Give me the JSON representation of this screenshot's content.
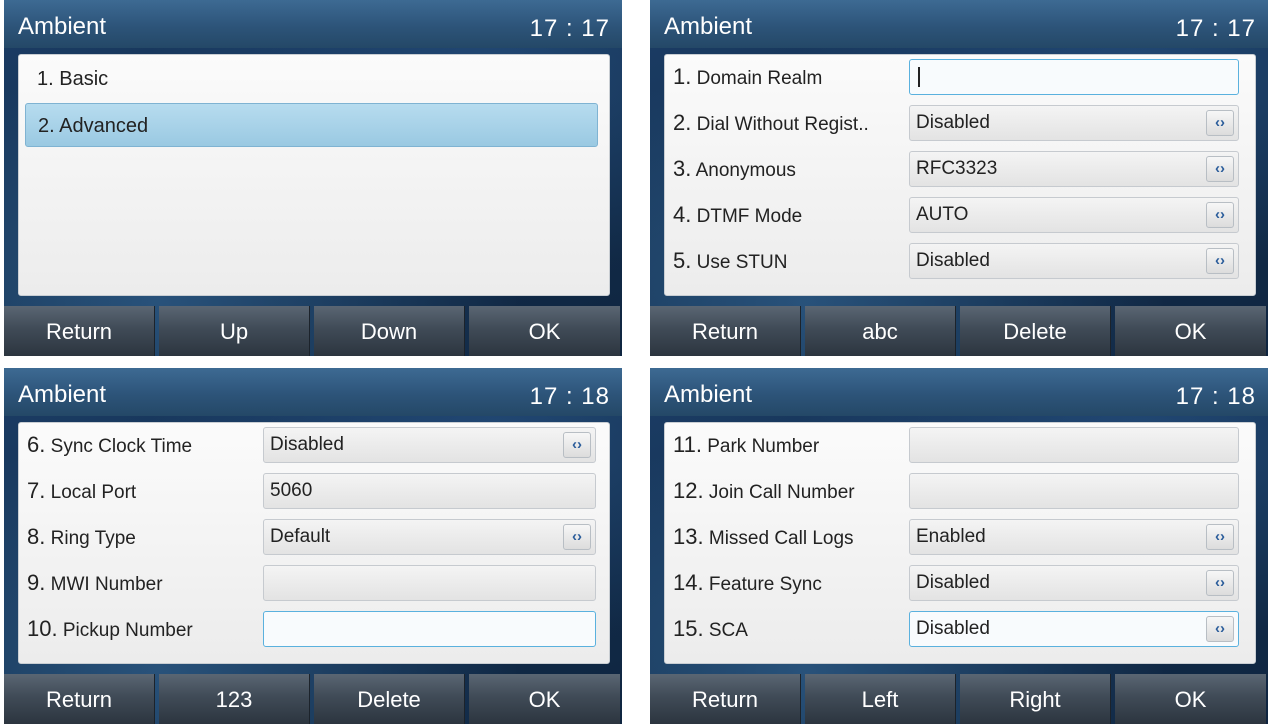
{
  "screens": [
    {
      "title": "Ambient",
      "time": "17 : 17",
      "menu": [
        "1. Basic",
        "2. Advanced"
      ],
      "selected_index": 1,
      "softkeys": [
        "Return",
        "Up",
        "Down",
        "OK"
      ]
    },
    {
      "title": "Ambient",
      "time": "17 : 17",
      "fields": [
        {
          "num": "1.",
          "label": "Domain Realm",
          "value": "",
          "type": "text"
        },
        {
          "num": "2.",
          "label": "Dial Without Regist..",
          "value": "Disabled",
          "type": "switch"
        },
        {
          "num": "3.",
          "label": "Anonymous",
          "value": "RFC3323",
          "type": "switch"
        },
        {
          "num": "4.",
          "label": "DTMF Mode",
          "value": "AUTO",
          "type": "switch"
        },
        {
          "num": "5.",
          "label": "Use STUN",
          "value": "Disabled",
          "type": "switch"
        }
      ],
      "focused_index": 0,
      "softkeys": [
        "Return",
        "abc",
        "Delete",
        "OK"
      ]
    },
    {
      "title": "Ambient",
      "time": "17 : 18",
      "fields": [
        {
          "num": "6.",
          "label": "Sync Clock Time",
          "value": "Disabled",
          "type": "switch"
        },
        {
          "num": "7.",
          "label": "Local Port",
          "value": "5060",
          "type": "text"
        },
        {
          "num": "8.",
          "label": "Ring Type",
          "value": "Default",
          "type": "switch"
        },
        {
          "num": "9.",
          "label": "MWI Number",
          "value": "",
          "type": "text"
        },
        {
          "num": "10.",
          "label": "Pickup Number",
          "value": "",
          "type": "text"
        }
      ],
      "focused_index": 4,
      "softkeys": [
        "Return",
        "123",
        "Delete",
        "OK"
      ]
    },
    {
      "title": "Ambient",
      "time": "17 : 18",
      "fields": [
        {
          "num": "11.",
          "label": "Park Number",
          "value": "",
          "type": "text"
        },
        {
          "num": "12.",
          "label": "Join Call Number",
          "value": "",
          "type": "text"
        },
        {
          "num": "13.",
          "label": "Missed Call Logs",
          "value": "Enabled",
          "type": "switch"
        },
        {
          "num": "14.",
          "label": "Feature Sync",
          "value": "Disabled",
          "type": "switch"
        },
        {
          "num": "15.",
          "label": "SCA",
          "value": "Disabled",
          "type": "switch"
        }
      ],
      "focused_index": 4,
      "softkeys": [
        "Return",
        "Left",
        "Right",
        "OK"
      ]
    }
  ],
  "switch_icon": "‹›"
}
